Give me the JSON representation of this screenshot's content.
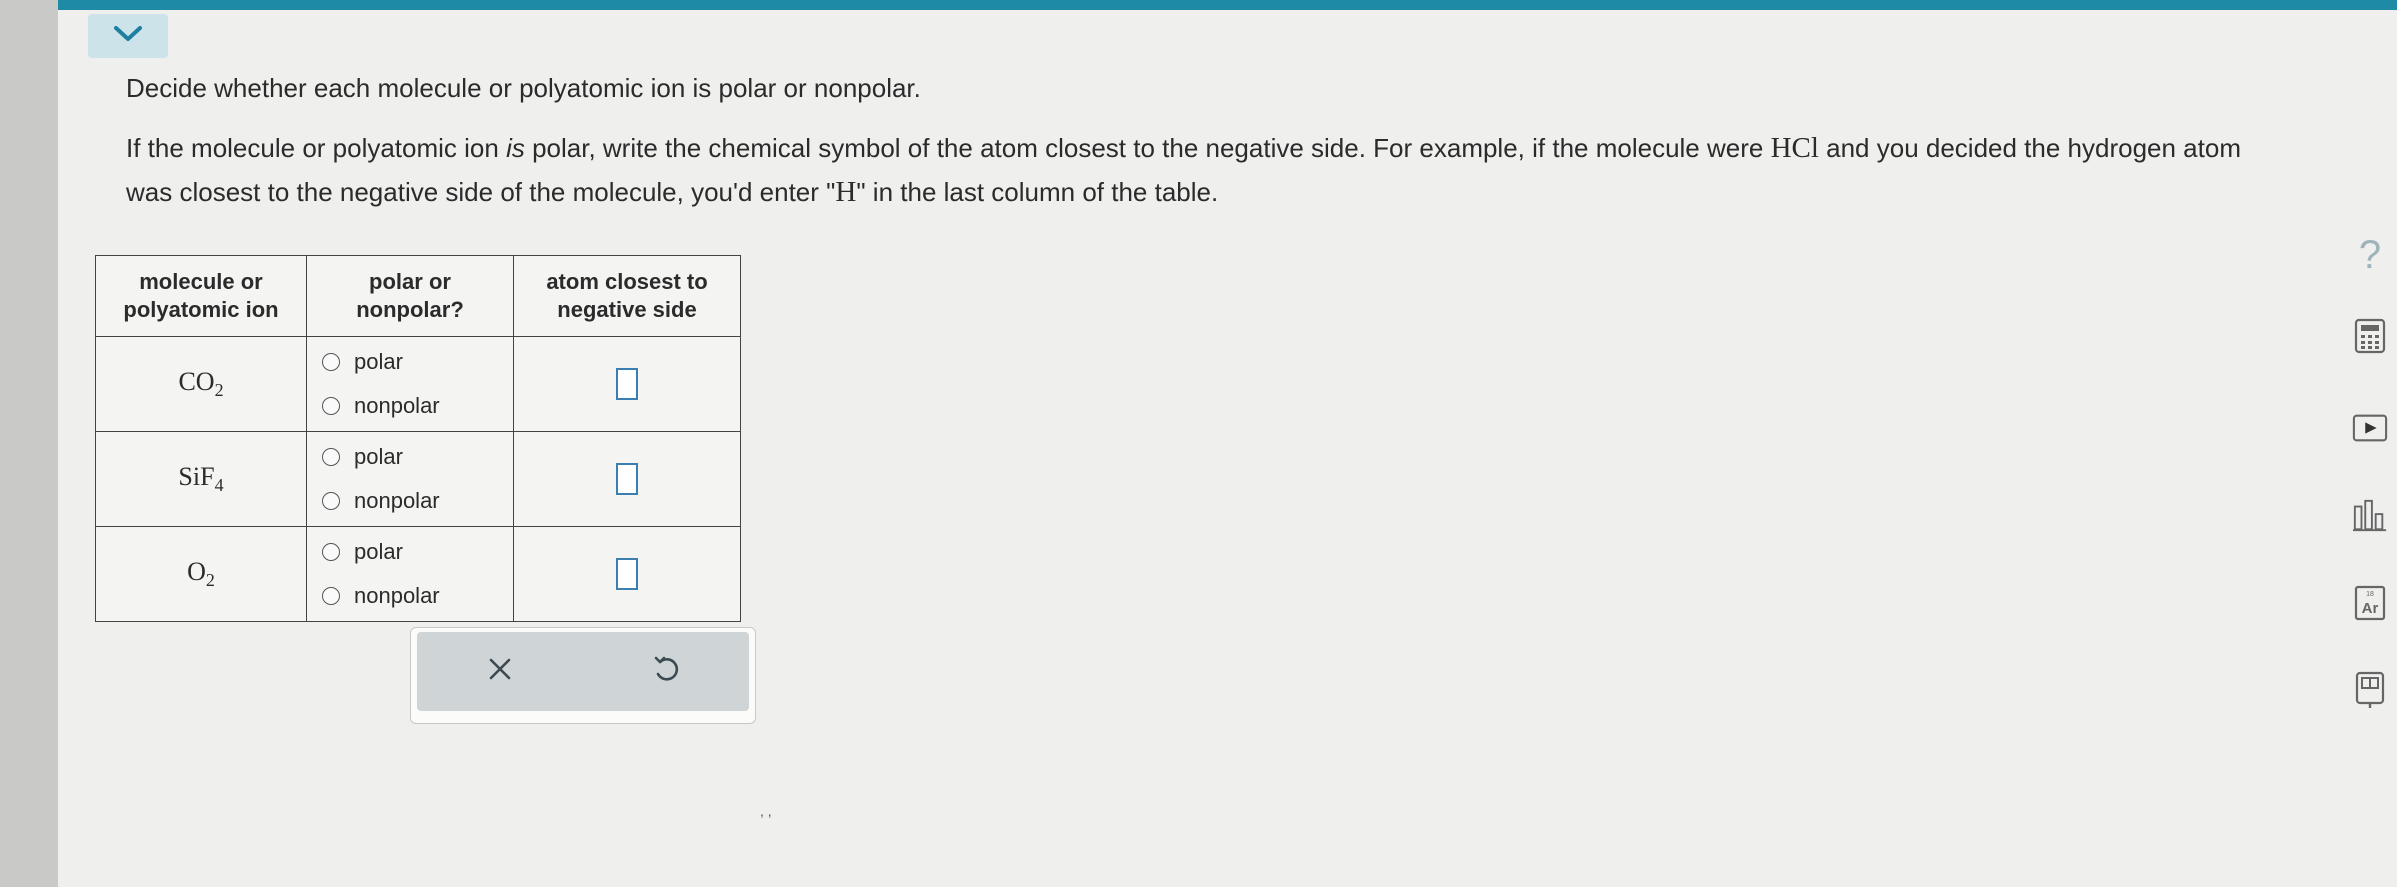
{
  "prompt": {
    "line1": "Decide whether each molecule or polyatomic ion is polar or nonpolar.",
    "line2_a": "If the molecule or polyatomic ion ",
    "line2_em": "is",
    "line2_b": " polar, write the chemical symbol of the atom closest to the negative side. For example, if the molecule were ",
    "example_formula": "HCl",
    "line2_c": " and you decided the hydrogen atom was closest to the negative side of the molecule, you'd enter \"",
    "example_answer": "H",
    "line2_d": "\" in the last column of the table."
  },
  "table": {
    "headers": {
      "col1_line1": "molecule or",
      "col1_line2": "polyatomic ion",
      "col2_line1": "polar or",
      "col2_line2": "nonpolar?",
      "col3_line1": "atom closest to",
      "col3_line2": "negative side"
    },
    "rows": [
      {
        "base": "CO",
        "sub": "2",
        "opt_polar": "polar",
        "opt_nonpolar": "nonpolar",
        "answer": ""
      },
      {
        "base": "SiF",
        "sub": "4",
        "opt_polar": "polar",
        "opt_nonpolar": "nonpolar",
        "answer": ""
      },
      {
        "base": "O",
        "sub": "2",
        "opt_polar": "polar",
        "opt_nonpolar": "nonpolar",
        "answer": ""
      }
    ]
  },
  "actions": {
    "clear_icon": "close-icon",
    "undo_icon": "undo-icon"
  },
  "tools": {
    "help_label": "?",
    "icons": [
      "calculator-icon",
      "video-play-icon",
      "bar-chart-icon",
      "periodic-table-icon",
      "book-icon"
    ]
  },
  "colors": {
    "accent": "#1f8aa6",
    "collapse_bg": "#cde3ea",
    "action_bg": "#cfd5d7"
  }
}
